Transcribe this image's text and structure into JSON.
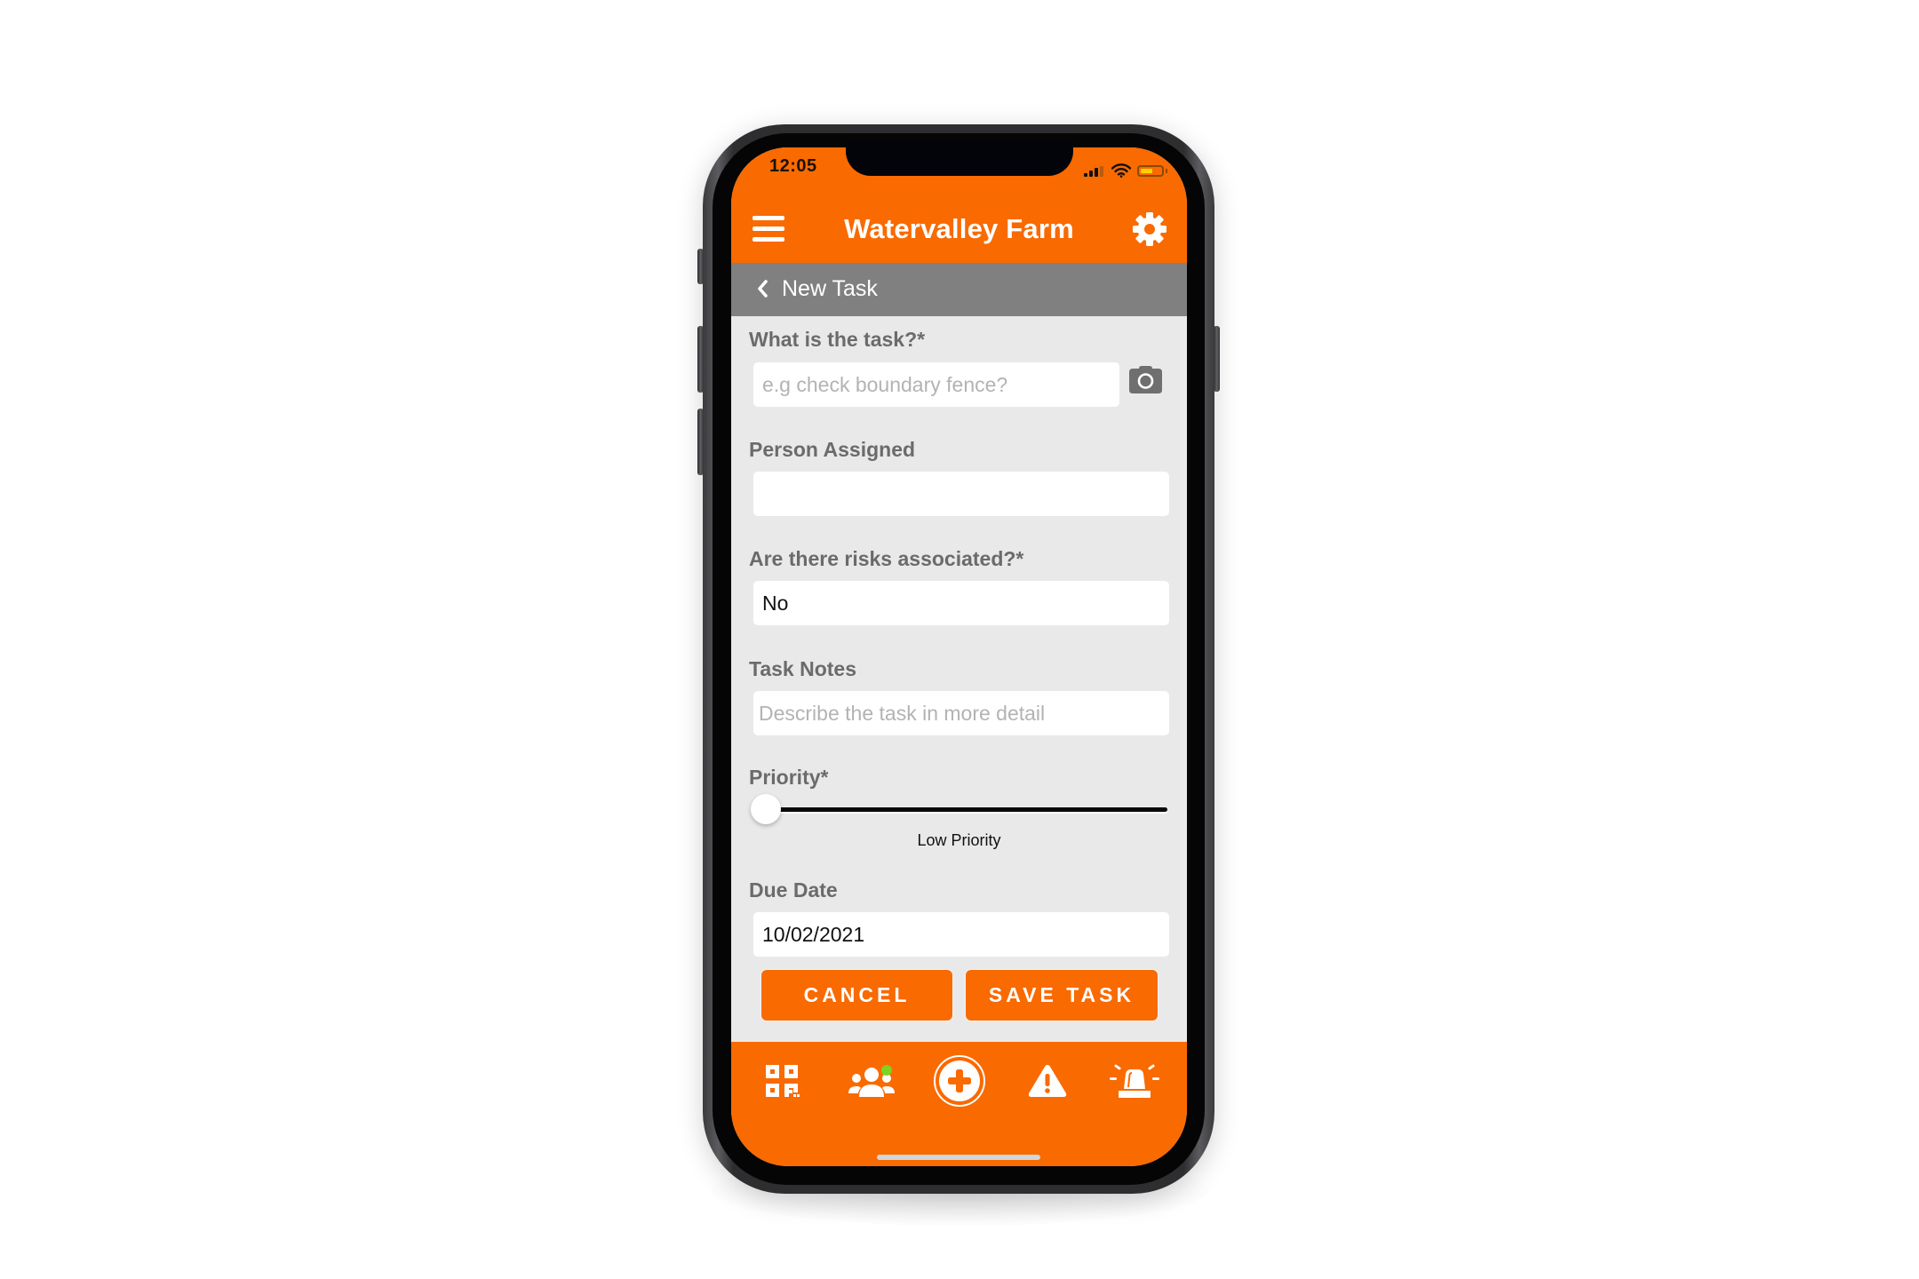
{
  "status_bar": {
    "time": "12:05"
  },
  "header": {
    "title": "Watervalley Farm",
    "menu_icon": "hamburger-menu-icon",
    "settings_icon": "gear-icon"
  },
  "subheader": {
    "back_icon": "chevron-left-icon",
    "title": "New Task"
  },
  "form": {
    "task": {
      "label": "What is the task?*",
      "value": "",
      "placeholder": "e.g check boundary fence?",
      "attachment_icon": "camera-icon"
    },
    "person_assigned": {
      "label": "Person Assigned",
      "value": "",
      "placeholder": ""
    },
    "risks": {
      "label": "Are there risks associated?*",
      "value": "No"
    },
    "notes": {
      "label": "Task Notes",
      "value": "",
      "placeholder": "Describe the task in more detail"
    },
    "priority": {
      "label": "Priority*",
      "value_fraction": 0,
      "caption": "Low Priority"
    },
    "due_date": {
      "label": "Due Date",
      "value": "10/02/2021"
    }
  },
  "actions": {
    "cancel_label": "CANCEL",
    "save_label": "SAVE TASK"
  },
  "tabbar": {
    "items": [
      {
        "name": "qr-code",
        "icon": "qr-code-icon"
      },
      {
        "name": "people",
        "icon": "people-group-icon",
        "badge": "online-dot"
      },
      {
        "name": "add",
        "icon": "plus-circle-icon"
      },
      {
        "name": "hazards",
        "icon": "warning-triangle-icon"
      },
      {
        "name": "emergency",
        "icon": "siren-icon"
      }
    ]
  },
  "colors": {
    "brand_orange": "#f96a00",
    "subheader_gray": "#808080",
    "content_bg": "#e9e9e9",
    "badge_green": "#7ed321"
  }
}
